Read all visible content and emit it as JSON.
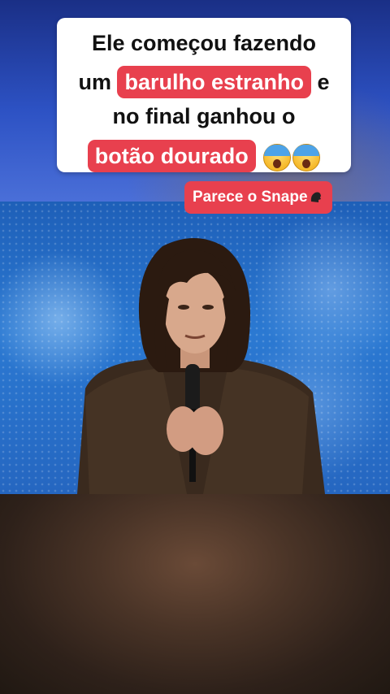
{
  "caption": {
    "line1": "Ele começou fazendo",
    "line2_prefix": "um",
    "line2_highlight": "barulho estranho",
    "line2_suffix": "e",
    "line3": "no final ganhou o",
    "line4_highlight": "botão dourado"
  },
  "snape_tag": {
    "label": "Parece o Snape"
  },
  "colors": {
    "highlight": "#e8404e",
    "card": "#ffffff",
    "stage_blue": "#2b79d2",
    "bottom_brown": "#4a3427"
  },
  "icons": [
    "screaming-face-icon",
    "speaking-head-icon"
  ]
}
